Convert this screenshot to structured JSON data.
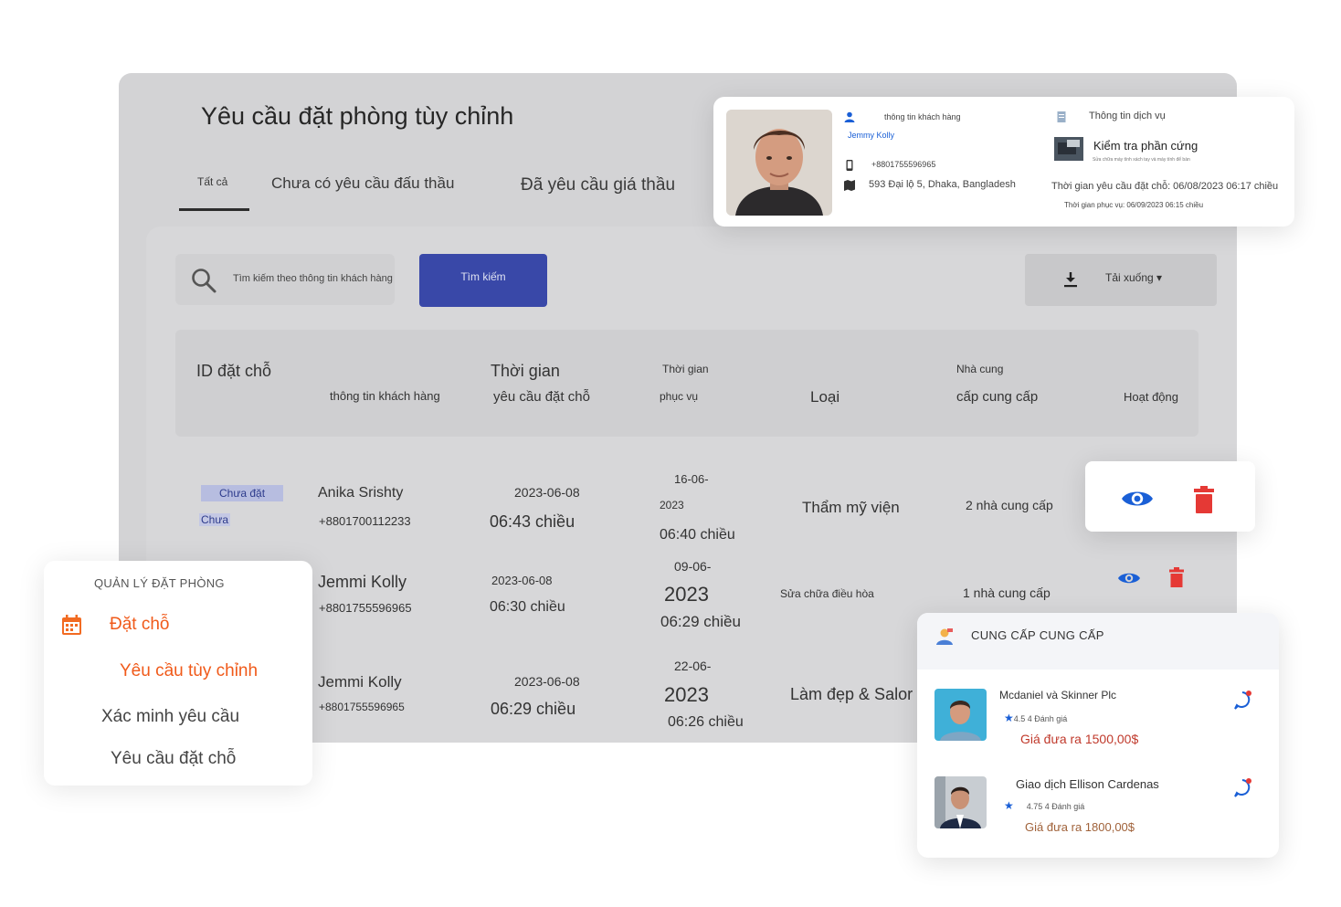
{
  "page": {
    "title": "Yêu cầu đặt phòng tùy chỉnh",
    "tabs": [
      {
        "label": "Tất cả",
        "active": true
      },
      {
        "label": "Chưa có yêu cầu đấu thầu",
        "active": false
      },
      {
        "label": "Đã yêu cầu giá thầu",
        "active": false
      }
    ]
  },
  "search": {
    "placeholder": "Tìm kiếm theo thông tin khách hàng",
    "button_label": "Tìm kiếm",
    "icon": "search-icon"
  },
  "download": {
    "label": "Tải xuống",
    "icon": "download-icon"
  },
  "table": {
    "headers": {
      "booking_id": "ID đặt chỗ",
      "customer_info": "thông tin khách hàng",
      "request_time_line1": "Thời gian",
      "request_time_line2": "yêu cầu đặt chỗ",
      "service_time_line1": "Thời gian",
      "service_time_line2": "phục vụ",
      "type": "Loại",
      "supplier_line1": "Nhà cung",
      "supplier_line2": "cấp cung cấp",
      "actions": "Hoạt động"
    },
    "rows": [
      {
        "status": "Chưa đặt",
        "status_sub": "Chưa",
        "name": "Anika Srishty",
        "phone": "+8801700112233",
        "request_date": "2023-06-08",
        "request_time": "06:43 chiều",
        "service_date_line1": "16-06-",
        "service_date_line2": "2023",
        "service_time": "06:40 chiều",
        "type": "Thẩm mỹ viện",
        "suppliers": "2 nhà cung cấp"
      },
      {
        "name": "Jemmi Kolly",
        "phone": "+8801755596965",
        "request_date": "2023-06-08",
        "request_time": "06:30 chiều",
        "service_date_line1": "09-06-",
        "service_date_line2": "2023",
        "service_time": "06:29 chiều",
        "type": "Sửa chữa điều hòa",
        "suppliers": "1 nhà cung cấp"
      },
      {
        "name": "Jemmi Kolly",
        "phone": "+8801755596965",
        "request_date": "2023-06-08",
        "request_time": "06:29 chiều",
        "service_date_line1": "22-06-",
        "service_date_line2": "2023",
        "service_time": "06:26 chiều",
        "type": "Làm đẹp & Salor"
      }
    ]
  },
  "customer_card": {
    "section_label": "thông tin khách hàng",
    "name": "Jemmy Kolly",
    "phone": "+8801755596965",
    "address": "593 Đại lộ 5, Dhaka, Bangladesh",
    "service_section_label": "Thông tin dịch vụ",
    "service_name": "Kiểm tra phần cứng",
    "service_desc": "Sửa chữa máy tính xách tay và máy tính để bàn",
    "request_time": "Thời gian yêu cầu đặt chỗ: 06/08/2023 06:17 chiều",
    "service_time": "Thời gian phục vụ: 06/09/2023 06:15 chiều"
  },
  "sidebar": {
    "title": "QUẢN LÝ ĐẶT PHÒNG",
    "items": [
      {
        "label": "Đặt chỗ",
        "active": true
      },
      {
        "label": "Yêu cầu tùy chỉnh",
        "active": true
      },
      {
        "label": "Xác minh yêu cầu",
        "active": false
      },
      {
        "label": "Yêu cầu đặt chỗ",
        "active": false
      }
    ]
  },
  "supplier_card": {
    "title": "CUNG CẤP CUNG CẤP",
    "suppliers": [
      {
        "name": "Mcdaniel và Skinner Plc",
        "rating": "4.5 4 Đánh giá",
        "offer": "Giá đưa ra 1500,00$"
      },
      {
        "name": "Giao dịch Ellison Cardenas",
        "rating": "4.75 4 Đánh giá",
        "offer": "Giá đưa ra 1800,00$"
      }
    ]
  },
  "colors": {
    "primary_blue": "#1a5fd6",
    "danger_red": "#e53935",
    "accent_orange": "#f05a1a",
    "offer_red": "#c0392b",
    "search_button": "#3948a8"
  }
}
